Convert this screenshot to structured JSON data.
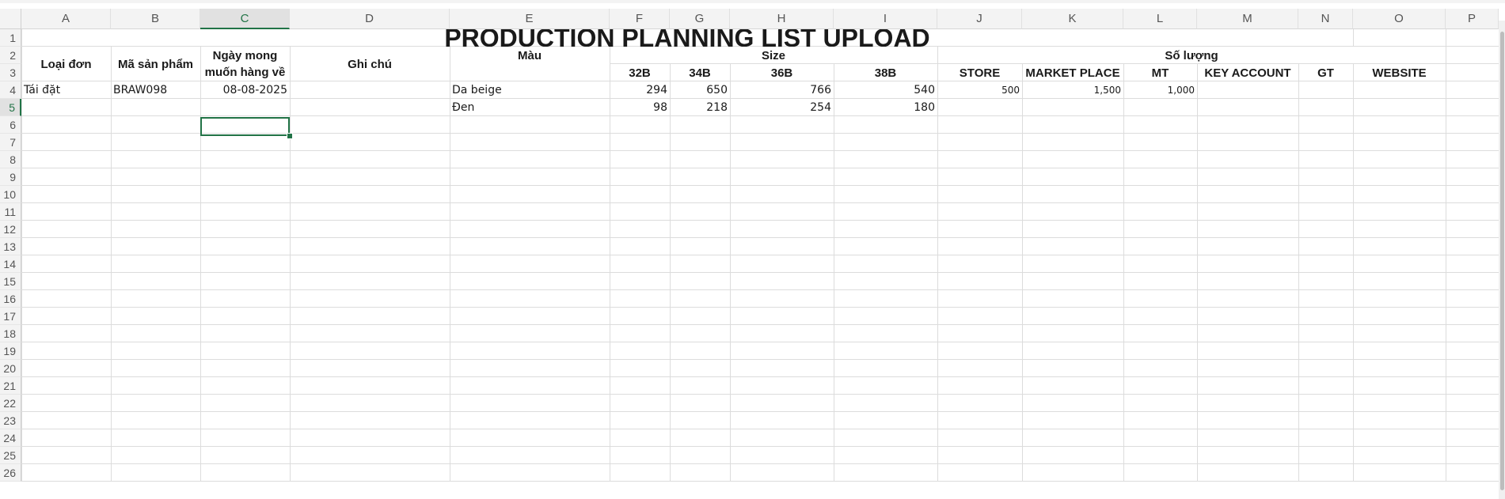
{
  "sheet": {
    "columns": [
      "A",
      "B",
      "C",
      "D",
      "E",
      "F",
      "G",
      "H",
      "I",
      "J",
      "K",
      "L",
      "M",
      "N",
      "O",
      "P"
    ],
    "selected_column": "C",
    "selected_row": 5,
    "title": "PRODUCTION PLANNING LIST UPLOAD",
    "headers": {
      "loai_don": "Loại đơn",
      "ma_san_pham": "Mã sản phẩm",
      "ngay_mong": "Ngày mong muốn hàng về",
      "ghi_chu": "Ghi chú",
      "mau": "Màu",
      "size": "Size",
      "so_luong": "Số lượng",
      "sizes": [
        "32B",
        "34B",
        "36B",
        "38B"
      ],
      "channels": [
        "STORE",
        "MARKET PLACE",
        "MT",
        "KEY ACCOUNT",
        "GT",
        "WEBSITE"
      ]
    },
    "rows": [
      {
        "loai_don": "Tái đặt",
        "ma_san_pham": "BRAW098",
        "ngay": "08-08-2025",
        "mau": "Da beige",
        "sizes": [
          "294",
          "650",
          "766",
          "540"
        ],
        "channels": [
          "500",
          "1,500",
          "1,000",
          "",
          "",
          ""
        ]
      },
      {
        "loai_don": "",
        "ma_san_pham": "",
        "ngay": "",
        "mau": "Đen",
        "sizes": [
          "98",
          "218",
          "254",
          "180"
        ],
        "channels": [
          "",
          "",
          "",
          "",
          "",
          ""
        ]
      }
    ]
  }
}
